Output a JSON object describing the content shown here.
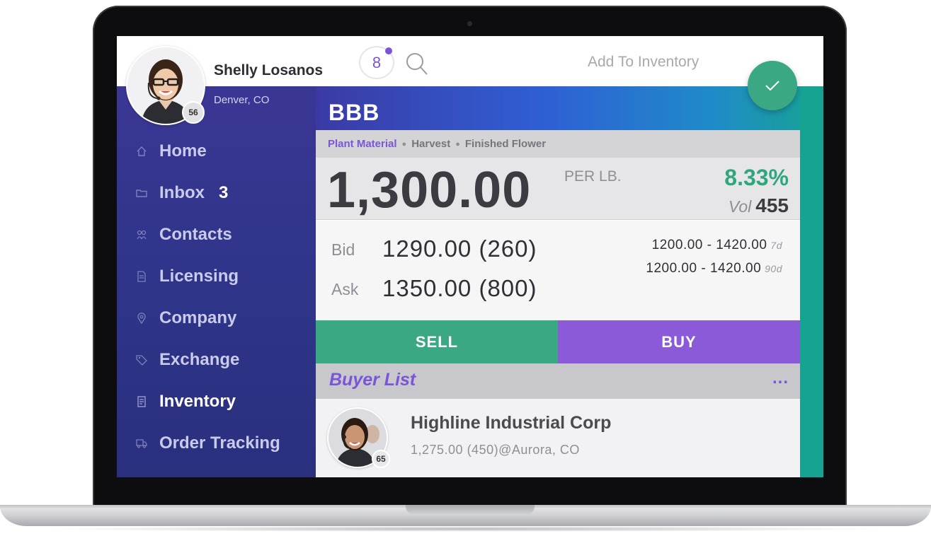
{
  "user": {
    "name": "Shelly Losanos",
    "location": "Denver, CO",
    "badge": "56"
  },
  "header": {
    "notification_count": "8",
    "action_label": "Add To Inventory"
  },
  "nav": {
    "items": [
      {
        "label": "Home",
        "icon": "home-icon"
      },
      {
        "label": "Inbox",
        "icon": "folder-icon",
        "count": "3"
      },
      {
        "label": "Contacts",
        "icon": "contacts-icon"
      },
      {
        "label": "Licensing",
        "icon": "document-icon"
      },
      {
        "label": "Company",
        "icon": "location-pin-icon"
      },
      {
        "label": "Exchange",
        "icon": "tag-icon"
      },
      {
        "label": "Inventory",
        "icon": "list-icon",
        "active": true
      },
      {
        "label": "Order Tracking",
        "icon": "truck-icon"
      }
    ]
  },
  "listing": {
    "symbol": "BBB",
    "breadcrumb": [
      "Plant Material",
      "Harvest",
      "Finished Flower"
    ],
    "price": "1,300.00",
    "unit": "PER LB.",
    "change": "8.33%",
    "vol_label": "Vol",
    "vol": "455",
    "bid_label": "Bid",
    "bid": "1290.00 (260)",
    "ask_label": "Ask",
    "ask": "1350.00 (800)",
    "ranges": [
      {
        "range": "1200.00 - 1420.00",
        "period": "7d"
      },
      {
        "range": "1200.00 - 1420.00",
        "period": "90d"
      }
    ],
    "sell_label": "SELL",
    "buy_label": "BUY"
  },
  "buyers": {
    "title": "Buyer List",
    "more": "...",
    "items": [
      {
        "name": "Highline Industrial Corp",
        "detail": "1,275.00 (450)@Aurora, CO",
        "badge": "65"
      }
    ]
  },
  "colors": {
    "accent_purple": "#7a55d6",
    "accent_green": "#3aa882",
    "sidebar": "#2e3488",
    "buy": "#8b5ad8"
  }
}
